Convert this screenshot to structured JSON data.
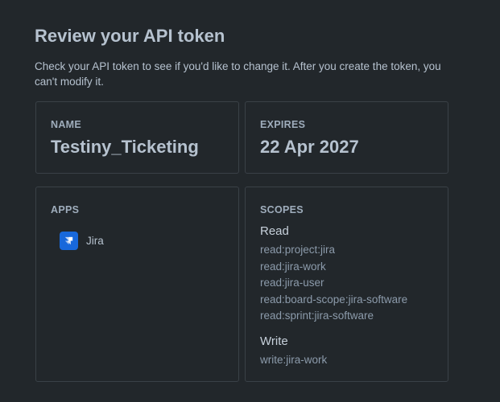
{
  "header": {
    "title": "Review your API token",
    "description": "Check your API token to see if you'd like to change it. After you create the token, you can't modify it."
  },
  "name_card": {
    "label": "NAME",
    "value": "Testiny_Ticketing"
  },
  "expires_card": {
    "label": "EXPIRES",
    "value": "22 Apr 2027"
  },
  "apps_card": {
    "label": "APPS",
    "apps": [
      {
        "name": "Jira",
        "icon": "jira-icon",
        "icon_color": "#1868db"
      }
    ]
  },
  "scopes_card": {
    "label": "SCOPES",
    "read": {
      "title": "Read",
      "items": [
        "read:project:jira",
        "read:jira-work",
        "read:jira-user",
        "read:board-scope:jira-software",
        "read:sprint:jira-software"
      ]
    },
    "write": {
      "title": "Write",
      "items": [
        "write:jira-work"
      ]
    }
  },
  "colors": {
    "background": "#22272b",
    "card_border": "#3a4147",
    "heading_text": "#b6c2cf",
    "muted_text": "#8c9bab"
  }
}
